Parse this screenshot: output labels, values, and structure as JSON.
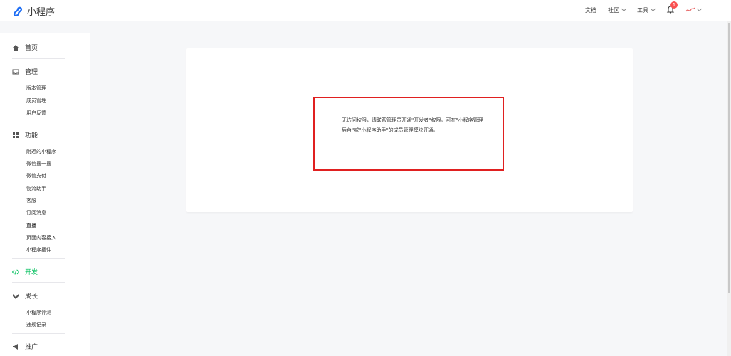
{
  "brand": {
    "name": "小程序",
    "color": "#1e6ef4"
  },
  "topnav": {
    "docs": "文档",
    "community": "社区",
    "tools": "工具",
    "notification_count": "1"
  },
  "sidebar": {
    "sections": [
      {
        "label": "首页",
        "icon": "home-icon"
      },
      {
        "label": "管理",
        "icon": "inbox-icon",
        "items": [
          "版本管理",
          "成员管理",
          "用户反馈"
        ]
      },
      {
        "label": "功能",
        "icon": "grid-icon",
        "items": [
          "附近的小程序",
          "微信搜一搜",
          "微信支付",
          "物流助手",
          "客服",
          "订阅消息",
          "直播",
          "页面内容接入",
          "小程序插件"
        ]
      },
      {
        "label": "开发",
        "icon": "code-icon",
        "active": true
      },
      {
        "label": "成长",
        "icon": "growth-icon",
        "items": [
          "小程序评测",
          "违规记录"
        ]
      },
      {
        "label": "推广",
        "icon": "megaphone-icon"
      }
    ]
  },
  "main": {
    "message": "无访问权限，请联系管理员开通\"开发者\"权限。可在\"小程序管理后台\"或\"小程序助手\"的成员管理模块开通。"
  },
  "colors": {
    "accent": "#07c160",
    "highlight_border": "#e02020",
    "badge": "#fa5151"
  }
}
